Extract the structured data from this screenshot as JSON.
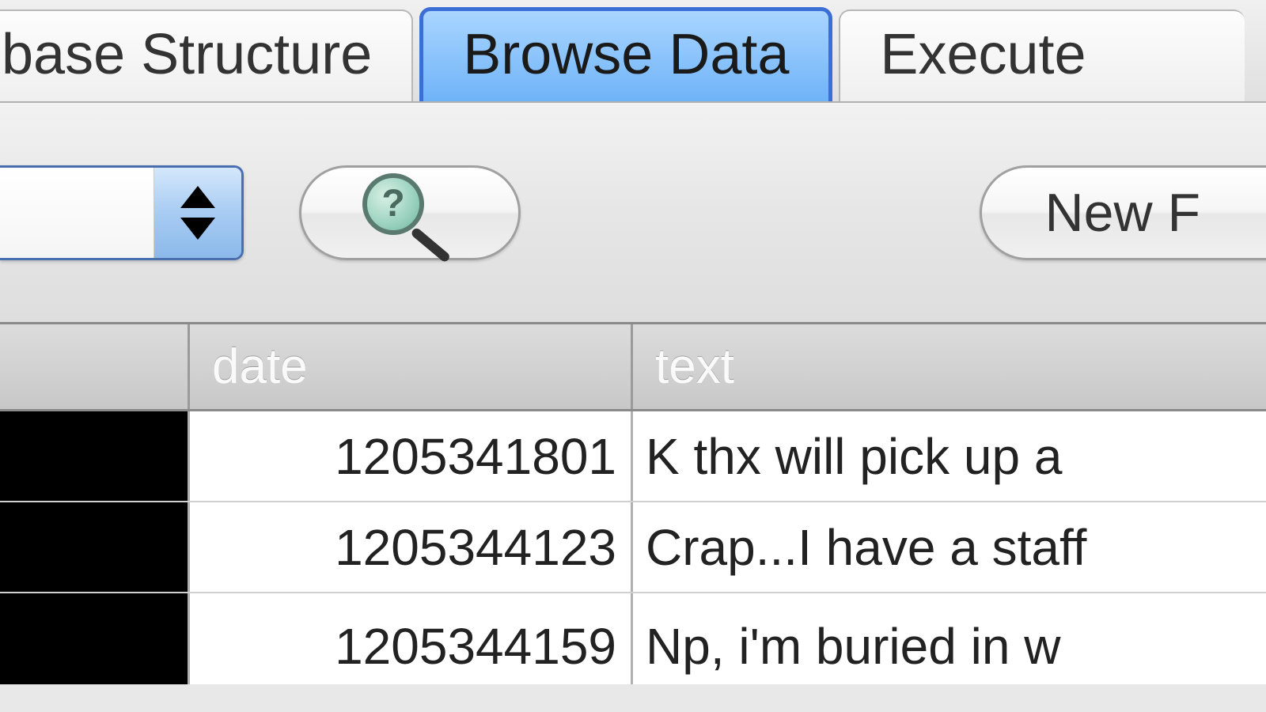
{
  "tabs": {
    "structure": "base Structure",
    "browse": "Browse Data",
    "execute": "Execute "
  },
  "toolbar": {
    "dropdown_value": "",
    "new_label": "New F"
  },
  "table": {
    "columns": {
      "date": "date",
      "text": "text"
    },
    "rows": [
      {
        "date": "1205341801",
        "text": "K thx will pick up a"
      },
      {
        "date": "1205344123",
        "text": "Crap...I have a staff"
      },
      {
        "date": "1205344159",
        "text": "Np, i'm buried in w"
      }
    ]
  }
}
